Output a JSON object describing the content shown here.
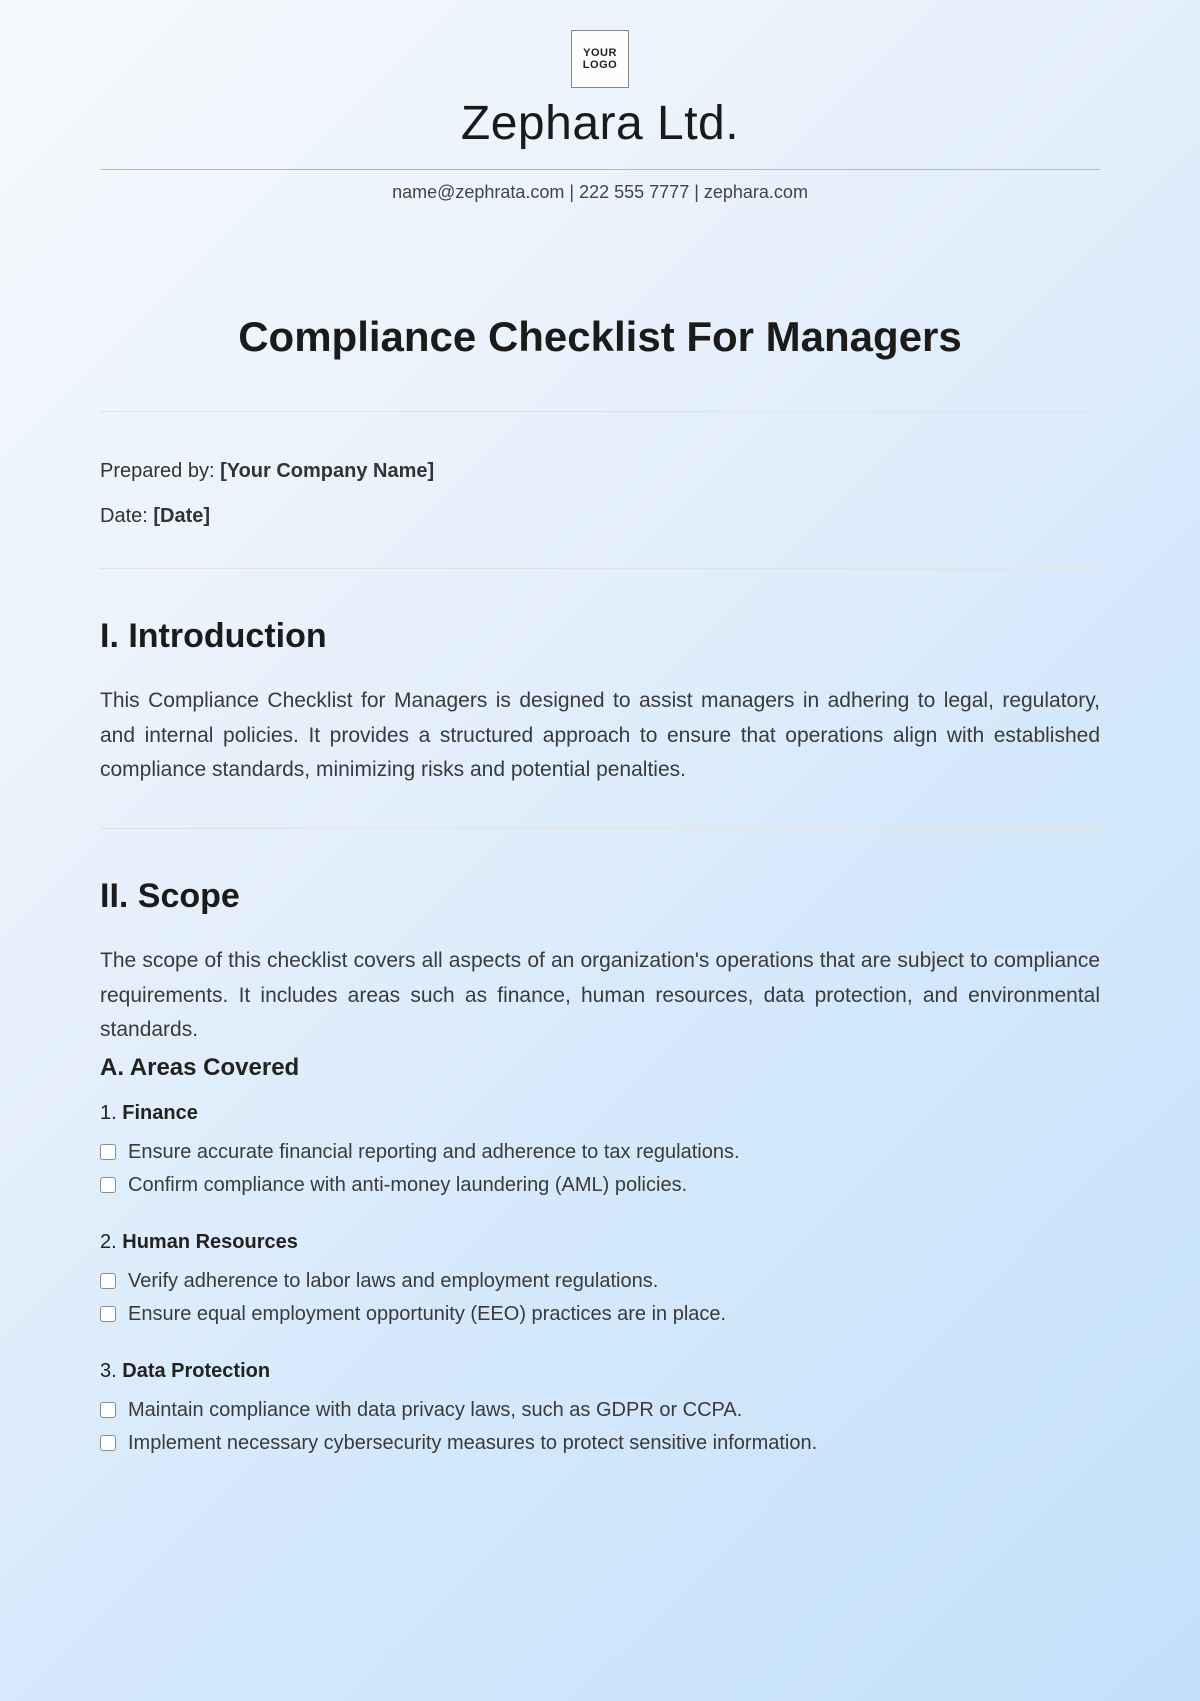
{
  "header": {
    "logo_text": "YOUR\nLOGO",
    "company_name": "Zephara Ltd.",
    "contact_line": "name@zephrata.com | 222 555 7777 | zephara.com"
  },
  "title": "Compliance Checklist For Managers",
  "meta": {
    "prepared_by_label": "Prepared by: ",
    "prepared_by_value": "[Your Company Name]",
    "date_label": "Date: ",
    "date_value": "[Date]"
  },
  "sections": {
    "intro": {
      "heading": "I. Introduction",
      "body": "This Compliance Checklist for Managers is designed to assist managers in adhering to legal, regulatory, and internal policies. It provides a structured approach to ensure that operations align with established compliance standards, minimizing risks and potential penalties."
    },
    "scope": {
      "heading": "II. Scope",
      "body": "The scope of this checklist covers all aspects of an organization's operations that are subject to compliance requirements. It includes areas such as finance, human resources, data protection, and environmental standards.",
      "sub_heading": "A. Areas Covered",
      "areas": [
        {
          "num": "1.",
          "label": "Finance",
          "items": [
            "Ensure accurate financial reporting and adherence to tax regulations.",
            "Confirm compliance with anti-money laundering (AML) policies."
          ]
        },
        {
          "num": "2.",
          "label": "Human Resources",
          "items": [
            "Verify adherence to labor laws and employment regulations.",
            "Ensure equal employment opportunity (EEO) practices are in place."
          ]
        },
        {
          "num": "3.",
          "label": "Data Protection",
          "items": [
            "Maintain compliance with data privacy laws, such as GDPR or CCPA.",
            "Implement necessary cybersecurity measures to protect sensitive information."
          ]
        }
      ]
    }
  }
}
